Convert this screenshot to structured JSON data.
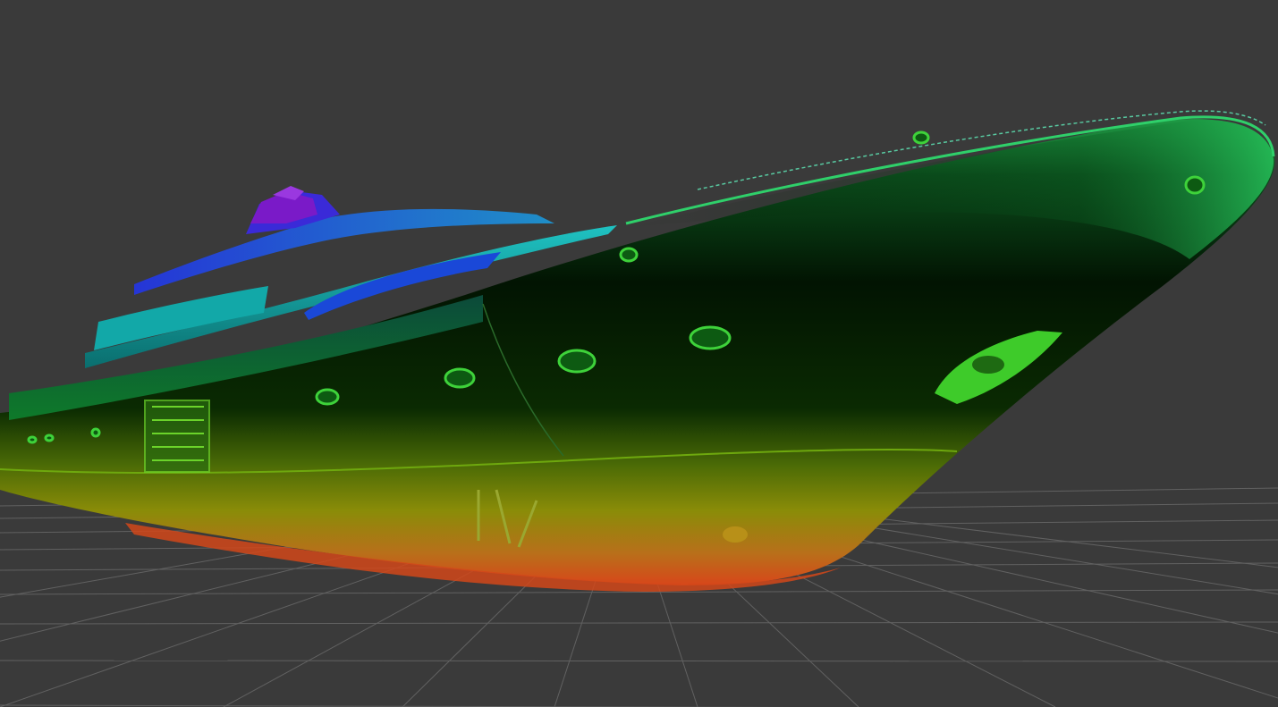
{
  "viewer": {
    "background_color": "#3a3a3a",
    "grid_color": "#6e6e6e",
    "grid_visible": true,
    "colormap": "height-rainbow",
    "colormap_stops": [
      "#e0401a",
      "#c9d400",
      "#1ea81e",
      "#0a3a0a",
      "#16c8c8",
      "#2a3ce0",
      "#7a20c8"
    ]
  },
  "scene": {
    "object": "point-cloud-yacht-hull",
    "portholes_visible": 10,
    "hull_color_top": "#22a84e",
    "hull_color_mid": "#021402",
    "hull_color_bottom": "#d8501a",
    "superstructure_color": "#1ec8c8",
    "top_deck_color": "#2838d8",
    "mast_color": "#7a1ac8"
  }
}
